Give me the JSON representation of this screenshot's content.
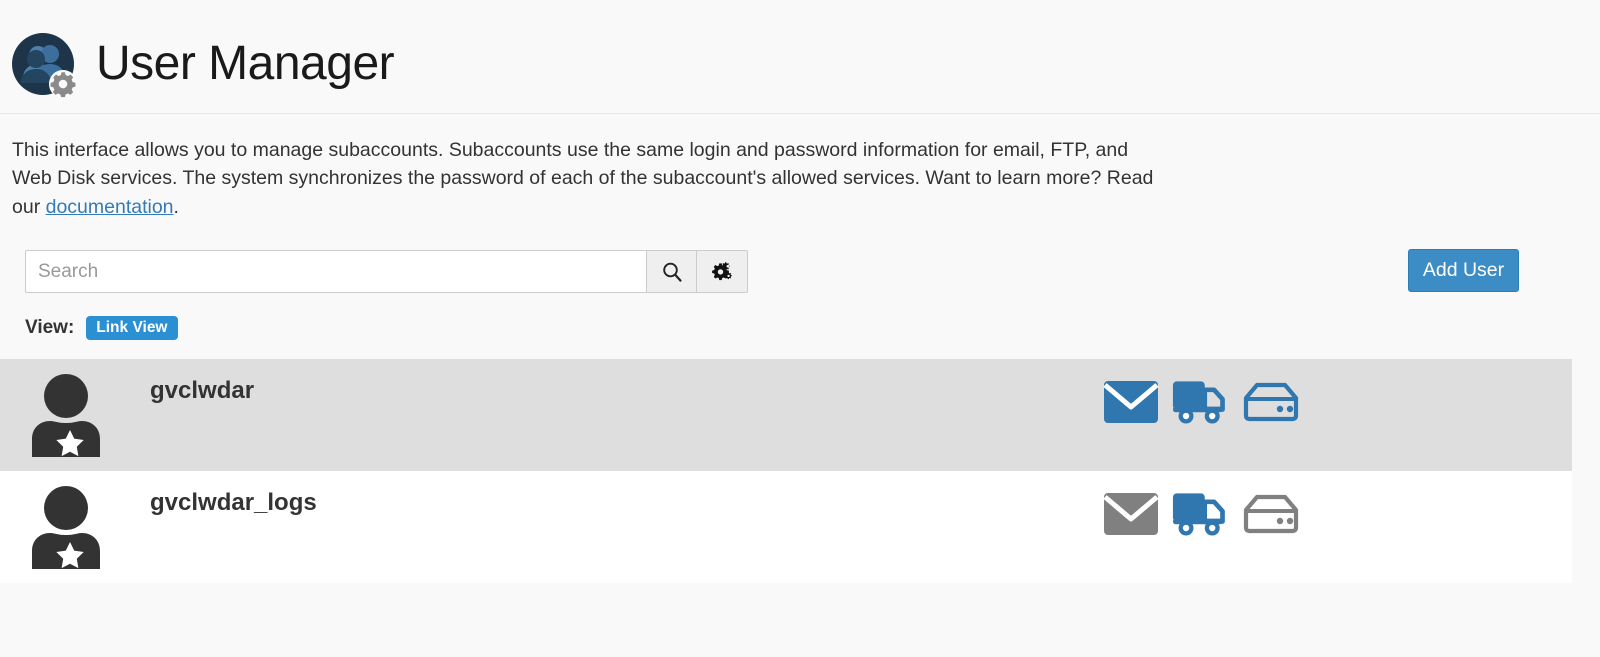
{
  "header": {
    "title": "User Manager",
    "icon": "users-gear-icon"
  },
  "description": {
    "line1": "This interface allows you to manage subaccounts. Subaccounts use the same login and password information for email, FTP, and Web Disk services. The system synchronizes the password of each of the subaccount's allowed services. Want to learn more? Read our ",
    "link_text": "documentation",
    "period": "."
  },
  "toolbar": {
    "search_placeholder": "Search",
    "search_value": "",
    "search_button_icon": "search-icon",
    "settings_button_icon": "cogs-icon",
    "add_user_label": "Add User"
  },
  "view": {
    "label": "View:",
    "active_option": "Link View"
  },
  "colors": {
    "accent_blue": "#3c8dc5",
    "badge_blue": "#2b8fd4",
    "service_active": "#3077b0",
    "service_inactive": "#808080",
    "link": "#337ab7",
    "row_shaded": "#dedede",
    "row_plain": "#ffffff",
    "page_background": "#f9f9f9",
    "avatar": "#333333"
  },
  "users": [
    {
      "username": "gvclwdar",
      "avatar_icon": "user-star-avatar-icon",
      "row_state": "shaded",
      "services": [
        {
          "name": "email-icon",
          "label": "Email",
          "enabled": true
        },
        {
          "name": "ftp-truck-icon",
          "label": "FTP",
          "enabled": true
        },
        {
          "name": "web-disk-icon",
          "label": "Web Disk",
          "enabled": true
        }
      ]
    },
    {
      "username": "gvclwdar_logs",
      "avatar_icon": "user-star-avatar-icon",
      "row_state": "plain",
      "services": [
        {
          "name": "email-icon",
          "label": "Email",
          "enabled": false
        },
        {
          "name": "ftp-truck-icon",
          "label": "FTP",
          "enabled": true
        },
        {
          "name": "web-disk-icon",
          "label": "Web Disk",
          "enabled": false
        }
      ]
    }
  ]
}
